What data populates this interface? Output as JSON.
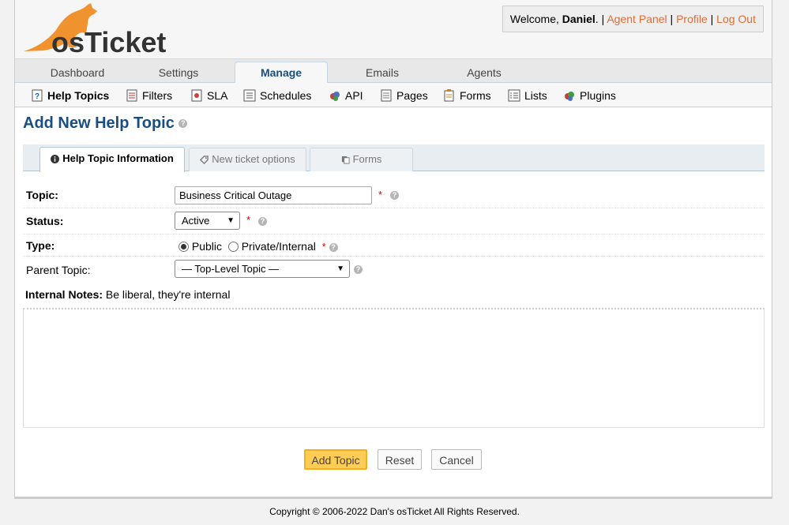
{
  "logo": {
    "text": "osTicket"
  },
  "header": {
    "welcome_prefix": "Welcome, ",
    "user_name": "Daniel",
    "welcome_suffix": ".",
    "sep": "|",
    "agent_panel": "Agent Panel",
    "profile": "Profile",
    "logout": "Log Out"
  },
  "nav": {
    "tabs": [
      {
        "label": "Dashboard",
        "icon": "none"
      },
      {
        "label": "Settings",
        "icon": "none"
      },
      {
        "label": "Manage",
        "icon": "none"
      },
      {
        "label": "Emails",
        "icon": "none"
      },
      {
        "label": "Agents",
        "icon": "none"
      }
    ],
    "active": "Manage"
  },
  "subnav": {
    "items": [
      {
        "label": "Help Topics",
        "icon": "help-topics-icon"
      },
      {
        "label": "Filters",
        "icon": "filters-icon"
      },
      {
        "label": "SLA",
        "icon": "sla-icon"
      },
      {
        "label": "Schedules",
        "icon": "schedules-icon"
      },
      {
        "label": "API",
        "icon": "api-icon"
      },
      {
        "label": "Pages",
        "icon": "pages-icon"
      },
      {
        "label": "Forms",
        "icon": "forms-icon"
      },
      {
        "label": "Lists",
        "icon": "lists-icon"
      },
      {
        "label": "Plugins",
        "icon": "plugins-icon"
      }
    ],
    "active": "Help Topics"
  },
  "page": {
    "title": "Add New Help Topic"
  },
  "form_tabs": [
    {
      "label": "Help Topic Information"
    },
    {
      "label": "New ticket options"
    },
    {
      "label": "Forms"
    }
  ],
  "form": {
    "topic": {
      "label": "Topic:",
      "value": "Business Critical Outage"
    },
    "status": {
      "label": "Status:",
      "value": "Active"
    },
    "type": {
      "label": "Type:",
      "option_public": "Public",
      "option_private": "Private/Internal",
      "selected": "Public"
    },
    "parent": {
      "label": "Parent Topic:",
      "value": "— Top-Level Topic —"
    },
    "notes": {
      "label": "Internal Notes:",
      "hint": "Be liberal, they're internal"
    },
    "required_mark": "*",
    "help_glyph": "?"
  },
  "buttons": {
    "add": "Add Topic",
    "reset": "Reset",
    "cancel": "Cancel"
  },
  "footer": {
    "text": "Copyright © 2006-2022 Dan's osTicket All Rights Reserved."
  },
  "colors": {
    "brand_orange": "#e06d35",
    "brand_blue": "#184e81",
    "primary_button": "#ffcc55"
  }
}
